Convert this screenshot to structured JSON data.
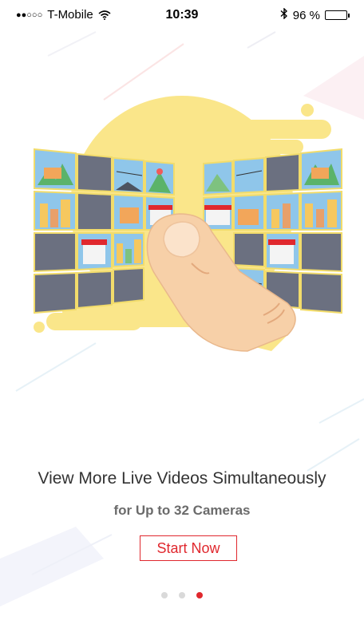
{
  "status_bar": {
    "signal_dots": "●●○○○",
    "carrier": "T-Mobile",
    "time": "10:39",
    "battery_percent": "96 %",
    "battery_level": 0.96,
    "icons": [
      "wifi-icon",
      "bluetooth-icon",
      "battery-icon"
    ]
  },
  "onboarding": {
    "headline": "View More Live Videos Simultaneously",
    "subheadline": "for Up to 32 Cameras",
    "start_label": "Start Now",
    "illustration": "camera-wall-with-finger-swipe",
    "pages": 3,
    "active_page": 3
  },
  "colors": {
    "accent": "#e0282e",
    "blob_yellow": "#fae68a",
    "tile_gray": "#6b7080",
    "tile_border": "#f2dc6b",
    "finger_skin": "#f7d0a8",
    "dot_inactive": "#d9d9d9",
    "text_primary": "#333333",
    "text_secondary": "#6b6b6b"
  }
}
